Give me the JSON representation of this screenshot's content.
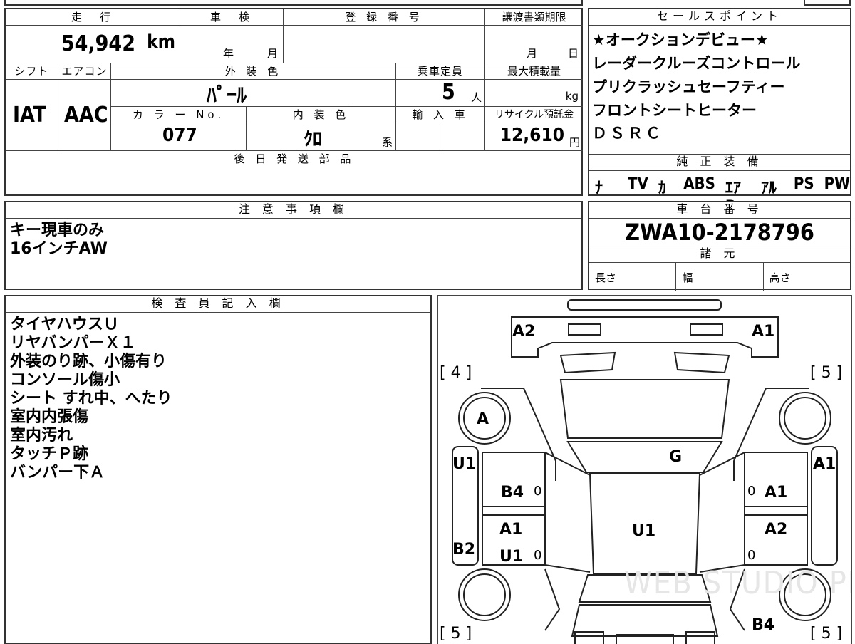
{
  "main_table": {
    "mileage_header": "走　行",
    "mileage_value": "54,942",
    "mileage_unit": "km",
    "shaken_header": "車　検",
    "shaken_year": "年",
    "shaken_month": "月",
    "reg_header": "登 録 番 号",
    "transfer_header": "譲渡書類期限",
    "transfer_month": "月",
    "transfer_day": "日",
    "shift_header": "シフト",
    "shift_value": "IAT",
    "ac_header": "エアコン",
    "ac_value": "AAC",
    "ext_color_header": "外 装 色",
    "ext_color_value": "ﾊﾟｰﾙ",
    "capacity_header": "乗車定員",
    "capacity_value": "5",
    "capacity_unit": "人",
    "max_load_header": "最大積載量",
    "max_load_unit": "kg",
    "color_no_header": "カ ラ ー No.",
    "color_no_value": "077",
    "int_color_header": "内 装 色",
    "int_color_value": "ｸﾛ",
    "int_color_suffix": "系",
    "import_header": "輸 入 車",
    "recycle_header": "リサイクル預託金",
    "recycle_value": "12,610",
    "recycle_unit": "円",
    "later_parts_header": "後 日 発 送 部 品"
  },
  "sales_points": {
    "header": "セールスポイント",
    "lines": [
      "★オークションデビュー★",
      "レーダークルーズコントロール",
      "プリクラッシュセーフティー",
      "フロントシートヒーター",
      "ＤＳＲＣ"
    ]
  },
  "equipment": {
    "header": "純 正 装 備",
    "items": [
      "ﾅﾋﾞ",
      "TV",
      "ｶﾜ",
      "ABS",
      "ｴｱB",
      "ｱﾙﾐ",
      "PS",
      "PW"
    ]
  },
  "notes": {
    "header": "注 意 事 項 欄",
    "lines": [
      "キー現車のみ",
      "16インチAW"
    ]
  },
  "chassis": {
    "header": "車 台 番 号",
    "value": "ZWA10-2178796",
    "spec_header": "諸 元",
    "length": "長さ",
    "width": "幅",
    "height": "高さ"
  },
  "inspector": {
    "header": "検 査 員 記 入 欄",
    "lines": [
      "タイヤハウスＵ",
      "リヤバンパーＸ１",
      "外装のり跡、小傷有り",
      "コンソール傷小",
      "シート すれ中、へたり",
      "室内内張傷",
      "室内汚れ",
      "タッチＰ跡",
      "バンパー下Ａ"
    ]
  },
  "diagram": {
    "marks": {
      "a2_front": "A2",
      "a1_front": "A1",
      "bracket_tl": "[ 4 ]",
      "bracket_tr": "[ 5 ]",
      "a_left_wheel": "A",
      "g_hood": "G",
      "u1_left": "U1",
      "a1_right": "A1",
      "b4_left_door": "B4",
      "a1_right_door": "A1",
      "a1_left_rear_door": "A1",
      "u1_left_rear_door": "U1",
      "u1_roof": "U1",
      "a2_right_rear_door": "A2",
      "b2_left": "B2",
      "b4_bottom_right": "B4",
      "bracket_bl": "[ 5 ]",
      "bracket_br": "[ 5 ]",
      "zero": "0"
    },
    "watermark": "WEB STUDIO PRO"
  }
}
